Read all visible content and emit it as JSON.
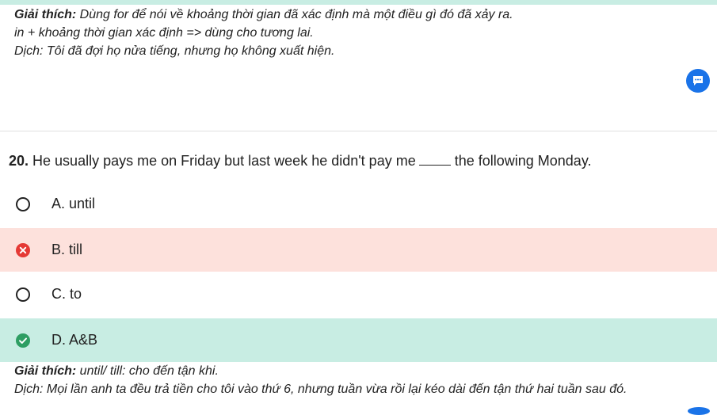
{
  "prev_explanation": {
    "label": "Giải thích:",
    "text1": " Dùng for để nói về khoảng thời gian đã xác định mà một điều gì đó đã xảy ra.",
    "line2": "in + khoảng thời gian xác định => dùng cho tương lai.",
    "line3": "Dịch: Tôi đã đợi họ nửa tiếng, nhưng họ không xuất hiện."
  },
  "question": {
    "number": "20.",
    "text_before": " He usually pays me on Friday but last week he didn't pay me",
    "text_after": "the following Monday."
  },
  "options": [
    {
      "label": "A. until",
      "state": "unselected"
    },
    {
      "label": "B. till",
      "state": "wrong"
    },
    {
      "label": "C. to",
      "state": "unselected"
    },
    {
      "label": "D. A&B",
      "state": "correct"
    }
  ],
  "explanation": {
    "label": "Giải thích:",
    "text1": " until/ till: cho đến tận khi.",
    "line2": "Dịch: Mọi lần anh ta đều trả tiền cho tôi vào thứ 6, nhưng tuần vừa rồi lại kéo dài đến tận thứ hai tuần sau đó."
  },
  "icons": {
    "chat": "chat-bubble-icon",
    "wrong": "x-circle-icon",
    "correct": "check-circle-icon"
  },
  "colors": {
    "correct_bg": "#c8ede3",
    "wrong_bg": "#fde1dc",
    "accent_blue": "#1a73e8",
    "wrong_red": "#e53935",
    "correct_green": "#2e9e63"
  }
}
